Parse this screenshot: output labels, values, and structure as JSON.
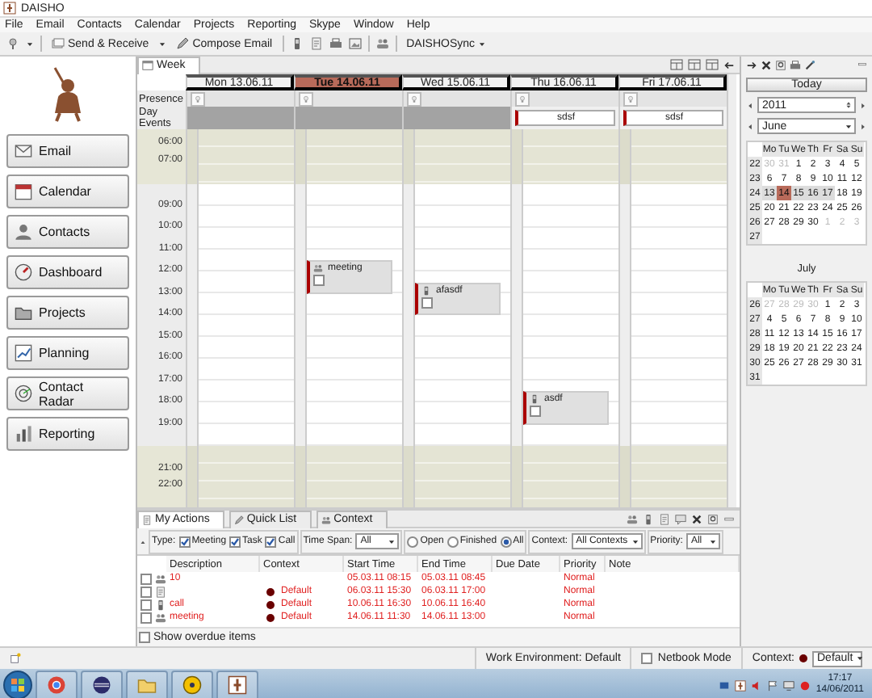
{
  "window": {
    "title": "DAISHO"
  },
  "menu": [
    "File",
    "Email",
    "Contacts",
    "Calendar",
    "Projects",
    "Reporting",
    "Skype",
    "Window",
    "Help"
  ],
  "toolbar": {
    "send_receive": "Send & Receive",
    "compose": "Compose Email",
    "sync": "DAISHOSync"
  },
  "sidebar": {
    "items": [
      {
        "label": "Email"
      },
      {
        "label": "Calendar"
      },
      {
        "label": "Contacts"
      },
      {
        "label": "Dashboard"
      },
      {
        "label": "Projects"
      },
      {
        "label": "Planning"
      },
      {
        "label": "Contact Radar"
      },
      {
        "label": "Reporting"
      }
    ]
  },
  "calendar": {
    "tab": "Week",
    "presence_label": "Presence",
    "day_events_label": "Day Events",
    "morning_hours": [
      "06:00",
      "07:00"
    ],
    "hours": [
      {
        "label": "09:00"
      },
      {
        "label": "10:00"
      },
      {
        "label": "11:00",
        "cells": [
          {
            "kind": "empty"
          },
          {
            "kind": "meeting",
            "title": "meeting",
            "checked": false
          }
        ]
      },
      {
        "label": "12:00",
        "cells": [
          {
            "kind": "empty"
          },
          {
            "kind": "empty"
          },
          {
            "kind": "call",
            "title": "afasdf",
            "checked": false
          }
        ]
      },
      {
        "label": "13:00"
      },
      {
        "label": "14:00"
      },
      {
        "label": "15:00"
      },
      {
        "label": "16:00"
      },
      {
        "label": "17:00",
        "cells": [
          {
            "kind": "empty"
          },
          {
            "kind": "empty"
          },
          {
            "kind": "empty"
          },
          {
            "kind": "call",
            "title": "asdf",
            "checked": false
          }
        ]
      },
      {
        "label": "18:00"
      },
      {
        "label": "19:00"
      }
    ],
    "evening_hours": [
      "21:00",
      "22:00"
    ],
    "days": [
      {
        "label": "Mon 13.06.11",
        "selected": false
      },
      {
        "label": "Tue 14.06.11",
        "selected": true
      },
      {
        "label": "Wed 15.06.11",
        "selected": false
      },
      {
        "label": "Thu 16.06.11",
        "selected": false,
        "day_events": [
          {
            "title": "sdsf"
          }
        ]
      },
      {
        "label": "Fri 17.06.11",
        "selected": false,
        "day_events": [
          {
            "title": "sdsf"
          }
        ]
      }
    ]
  },
  "navigator": {
    "today": "Today",
    "year": "2011",
    "month": "June",
    "months": [
      {
        "weekdays": [
          "Mo",
          "Tu",
          "We",
          "Th",
          "Fr",
          "Sa",
          "Su"
        ],
        "weeks": [
          {
            "number": "22",
            "days": [
              {
                "day": "30",
                "outside": true,
                "selected": false,
                "in_view": false
              },
              {
                "day": "31",
                "outside": true,
                "selected": false,
                "in_view": false
              },
              {
                "day": "1",
                "outside": false,
                "selected": false,
                "in_view": false
              },
              {
                "day": "2",
                "outside": false,
                "selected": false,
                "in_view": false
              },
              {
                "day": "3",
                "outside": false,
                "selected": false,
                "in_view": false
              },
              {
                "day": "4",
                "outside": false,
                "selected": false,
                "in_view": false
              },
              {
                "day": "5",
                "outside": false,
                "selected": false,
                "in_view": false
              }
            ]
          },
          {
            "number": "23",
            "days": [
              {
                "day": "6",
                "outside": false,
                "selected": false,
                "in_view": false
              },
              {
                "day": "7",
                "outside": false,
                "selected": false,
                "in_view": false
              },
              {
                "day": "8",
                "outside": false,
                "selected": false,
                "in_view": false
              },
              {
                "day": "9",
                "outside": false,
                "selected": false,
                "in_view": false
              },
              {
                "day": "10",
                "outside": false,
                "selected": false,
                "in_view": false
              },
              {
                "day": "11",
                "outside": false,
                "selected": false,
                "in_view": false
              },
              {
                "day": "12",
                "outside": false,
                "selected": false,
                "in_view": false
              }
            ]
          },
          {
            "number": "24",
            "days": [
              {
                "day": "13",
                "outside": false,
                "selected": false,
                "in_view": true
              },
              {
                "day": "14",
                "outside": false,
                "selected": true,
                "in_view": true
              },
              {
                "day": "15",
                "outside": false,
                "selected": false,
                "in_view": true
              },
              {
                "day": "16",
                "outside": false,
                "selected": false,
                "in_view": true
              },
              {
                "day": "17",
                "outside": false,
                "selected": false,
                "in_view": true
              },
              {
                "day": "18",
                "outside": false,
                "selected": false,
                "in_view": false
              },
              {
                "day": "19",
                "outside": false,
                "selected": false,
                "in_view": false
              }
            ]
          },
          {
            "number": "25",
            "days": [
              {
                "day": "20",
                "outside": false,
                "selected": false,
                "in_view": false
              },
              {
                "day": "21",
                "outside": false,
                "selected": false,
                "in_view": false
              },
              {
                "day": "22",
                "outside": false,
                "selected": false,
                "in_view": false
              },
              {
                "day": "23",
                "outside": false,
                "selected": false,
                "in_view": false
              },
              {
                "day": "24",
                "outside": false,
                "selected": false,
                "in_view": false
              },
              {
                "day": "25",
                "outside": false,
                "selected": false,
                "in_view": false
              },
              {
                "day": "26",
                "outside": false,
                "selected": false,
                "in_view": false
              }
            ]
          },
          {
            "number": "26",
            "days": [
              {
                "day": "27",
                "outside": false,
                "selected": false,
                "in_view": false
              },
              {
                "day": "28",
                "outside": false,
                "selected": false,
                "in_view": false
              },
              {
                "day": "29",
                "outside": false,
                "selected": false,
                "in_view": false
              },
              {
                "day": "30",
                "outside": false,
                "selected": false,
                "in_view": false
              },
              {
                "day": "1",
                "outside": true,
                "selected": false,
                "in_view": false
              },
              {
                "day": "2",
                "outside": true,
                "selected": false,
                "in_view": false
              },
              {
                "day": "3",
                "outside": true,
                "selected": false,
                "in_view": false
              }
            ]
          },
          {
            "number": "27"
          }
        ]
      },
      {
        "title": "July",
        "weekdays": [
          "Mo",
          "Tu",
          "We",
          "Th",
          "Fr",
          "Sa",
          "Su"
        ],
        "weeks": [
          {
            "number": "26",
            "days": [
              {
                "day": "27",
                "outside": true,
                "selected": false,
                "in_view": false
              },
              {
                "day": "28",
                "outside": true,
                "selected": false,
                "in_view": false
              },
              {
                "day": "29",
                "outside": true,
                "selected": false,
                "in_view": false
              },
              {
                "day": "30",
                "outside": true,
                "selected": false,
                "in_view": false
              },
              {
                "day": "1",
                "outside": false,
                "selected": false,
                "in_view": false
              },
              {
                "day": "2",
                "outside": false,
                "selected": false,
                "in_view": false
              },
              {
                "day": "3",
                "outside": false,
                "selected": false,
                "in_view": false
              }
            ]
          },
          {
            "number": "27",
            "days": [
              {
                "day": "4",
                "outside": false,
                "selected": false,
                "in_view": false
              },
              {
                "day": "5",
                "outside": false,
                "selected": false,
                "in_view": false
              },
              {
                "day": "6",
                "outside": false,
                "selected": false,
                "in_view": false
              },
              {
                "day": "7",
                "outside": false,
                "selected": false,
                "in_view": false
              },
              {
                "day": "8",
                "outside": false,
                "selected": false,
                "in_view": false
              },
              {
                "day": "9",
                "outside": false,
                "selected": false,
                "in_view": false
              },
              {
                "day": "10",
                "outside": false,
                "selected": false,
                "in_view": false
              }
            ]
          },
          {
            "number": "28",
            "days": [
              {
                "day": "11",
                "outside": false,
                "selected": false,
                "in_view": false
              },
              {
                "day": "12",
                "outside": false,
                "selected": false,
                "in_view": false
              },
              {
                "day": "13",
                "outside": false,
                "selected": false,
                "in_view": false
              },
              {
                "day": "14",
                "outside": false,
                "selected": false,
                "in_view": false
              },
              {
                "day": "15",
                "outside": false,
                "selected": false,
                "in_view": false
              },
              {
                "day": "16",
                "outside": false,
                "selected": false,
                "in_view": false
              },
              {
                "day": "17",
                "outside": false,
                "selected": false,
                "in_view": false
              }
            ]
          },
          {
            "number": "29",
            "days": [
              {
                "day": "18",
                "outside": false,
                "selected": false,
                "in_view": false
              },
              {
                "day": "19",
                "outside": false,
                "selected": false,
                "in_view": false
              },
              {
                "day": "20",
                "outside": false,
                "selected": false,
                "in_view": false
              },
              {
                "day": "21",
                "outside": false,
                "selected": false,
                "in_view": false
              },
              {
                "day": "22",
                "outside": false,
                "selected": false,
                "in_view": false
              },
              {
                "day": "23",
                "outside": false,
                "selected": false,
                "in_view": false
              },
              {
                "day": "24",
                "outside": false,
                "selected": false,
                "in_view": false
              }
            ]
          },
          {
            "number": "30",
            "days": [
              {
                "day": "25",
                "outside": false,
                "selected": false,
                "in_view": false
              },
              {
                "day": "26",
                "outside": false,
                "selected": false,
                "in_view": false
              },
              {
                "day": "27",
                "outside": false,
                "selected": false,
                "in_view": false
              },
              {
                "day": "28",
                "outside": false,
                "selected": false,
                "in_view": false
              },
              {
                "day": "29",
                "outside": false,
                "selected": false,
                "in_view": false
              },
              {
                "day": "30",
                "outside": false,
                "selected": false,
                "in_view": false
              },
              {
                "day": "31",
                "outside": false,
                "selected": false,
                "in_view": false
              }
            ]
          },
          {
            "number": "31"
          }
        ]
      }
    ]
  },
  "actions": {
    "tabs": [
      {
        "label": "My Actions",
        "selected": true
      },
      {
        "label": "Quick List",
        "selected": false
      },
      {
        "label": "Context",
        "selected": false
      }
    ],
    "filters": {
      "type_label": "Type:",
      "types": [
        {
          "label": "Meeting",
          "checked": true
        },
        {
          "label": "Task",
          "checked": true
        },
        {
          "label": "Call",
          "checked": true
        }
      ],
      "time_span_label": "Time Span:",
      "time_span": "All",
      "status": [
        {
          "label": "Open",
          "selected": false
        },
        {
          "label": "Finished",
          "selected": false
        },
        {
          "label": "All",
          "selected": true
        }
      ],
      "context_label": "Context:",
      "context": "All Contexts",
      "priority_label": "Priority:",
      "priority": "All"
    },
    "columns": [
      "Description",
      "Context",
      "Start Time",
      "End Time",
      "Due Date",
      "Priority",
      "Note"
    ],
    "rows": [
      {
        "kind": "meeting",
        "description": "10",
        "start": "05.03.11 08:15",
        "end": "05.03.11 08:45",
        "priority": "Normal",
        "overdue": true,
        "checked": false
      },
      {
        "kind": "task",
        "context": "Default",
        "start": "06.03.11 15:30",
        "end": "06.03.11 17:00",
        "priority": "Normal",
        "overdue": true,
        "checked": false
      },
      {
        "kind": "call",
        "description": "call",
        "context": "Default",
        "start": "10.06.11 16:30",
        "end": "10.06.11 16:40",
        "priority": "Normal",
        "overdue": true,
        "checked": false
      },
      {
        "kind": "meeting",
        "description": "meeting",
        "context": "Default",
        "start": "14.06.11 11:30",
        "end": "14.06.11 13:00",
        "priority": "Normal",
        "overdue": true,
        "checked": false
      }
    ],
    "show_overdue": {
      "label": "Show overdue items",
      "checked": false
    }
  },
  "status_bar": {
    "work_environment": "Work Environment: Default",
    "netbook_mode": {
      "label": "Netbook Mode",
      "checked": false
    },
    "context_label": "Context:",
    "context": "Default"
  },
  "taskbar": {
    "time": "17:17",
    "date": "14/06/2011"
  }
}
